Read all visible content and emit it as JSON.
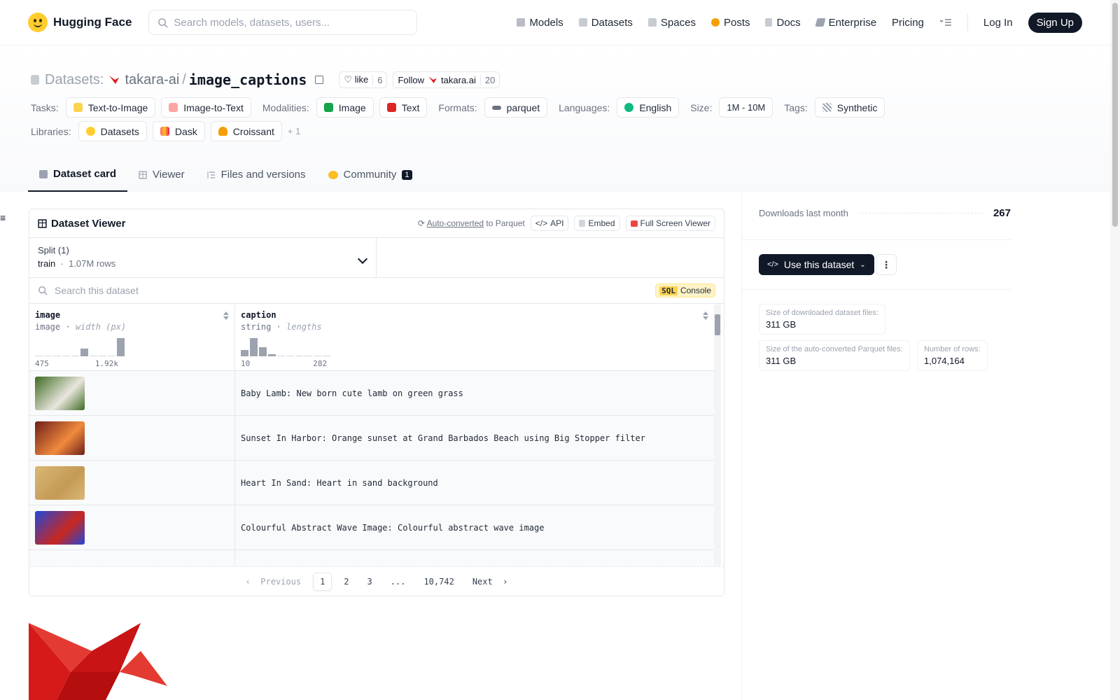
{
  "nav": {
    "brand": "Hugging Face",
    "search_placeholder": "Search models, datasets, users...",
    "links": [
      "Models",
      "Datasets",
      "Spaces",
      "Posts",
      "Docs",
      "Enterprise",
      "Pricing"
    ],
    "login": "Log In",
    "signup": "Sign Up"
  },
  "repo": {
    "section": "Datasets:",
    "owner": "takara-ai",
    "sep": "/",
    "name": "image_captions",
    "like_label": "like",
    "like_count": "6",
    "follow_label": "Follow",
    "follow_org": "takara.ai",
    "follow_count": "20"
  },
  "tags": {
    "tasks_label": "Tasks:",
    "tasks": [
      "Text-to-Image",
      "Image-to-Text"
    ],
    "modalities_label": "Modalities:",
    "modalities": [
      "Image",
      "Text"
    ],
    "formats_label": "Formats:",
    "formats": [
      "parquet"
    ],
    "languages_label": "Languages:",
    "languages": [
      "English"
    ],
    "size_label": "Size:",
    "size": "1M - 10M",
    "tags_label": "Tags:",
    "tag_list": [
      "Synthetic"
    ],
    "libraries_label": "Libraries:",
    "libraries": [
      "Datasets",
      "Dask",
      "Croissant"
    ],
    "libraries_more": "+ 1"
  },
  "tabs": [
    "Dataset card",
    "Viewer",
    "Files and versions",
    "Community"
  ],
  "community_badge": "1",
  "viewer": {
    "title": "Dataset Viewer",
    "auto_converted": "Auto-converted",
    "to_parquet": "to Parquet",
    "api": "API",
    "embed": "Embed",
    "fullscreen": "Full Screen Viewer",
    "split_label": "Split (1)",
    "split_name": "train",
    "split_rows": "1.07M rows",
    "search_placeholder": "Search this dataset",
    "sql_tag": "SQL",
    "sql_label": "Console",
    "columns": [
      {
        "name": "image",
        "type": "image",
        "sub": "width (px)",
        "min": "475",
        "max": "1.92k"
      },
      {
        "name": "caption",
        "type": "string",
        "sub": "lengths",
        "min": "10",
        "max": "282"
      }
    ],
    "rows": [
      {
        "caption": "Baby Lamb: New born cute lamb on green grass",
        "thumb": [
          "#3e6b22",
          "#e9e6de"
        ]
      },
      {
        "caption": "Sunset In Harbor: Orange sunset at Grand Barbados Beach using Big Stopper filter",
        "thumb": [
          "#6e1f1a",
          "#f08a3c"
        ]
      },
      {
        "caption": "Heart In Sand: Heart in sand background",
        "thumb": [
          "#d9b877",
          "#c49a55"
        ]
      },
      {
        "caption": "Colourful Abstract Wave Image: Colourful abstract wave image",
        "thumb": [
          "#2347d8",
          "#c8271f"
        ]
      },
      {
        "caption": "",
        "thumb": [
          "#2f4a1c",
          "#c0392b"
        ]
      }
    ],
    "pager": {
      "prev": "Previous",
      "pages": [
        "1",
        "2",
        "3",
        "...",
        "10,742"
      ],
      "next": "Next"
    }
  },
  "sidebar": {
    "downloads_label": "Downloads last month",
    "downloads_value": "267",
    "use_button": "Use this dataset",
    "stats": [
      {
        "label": "Size of downloaded dataset files:",
        "value": "311 GB"
      },
      {
        "label": "Size of the auto-converted Parquet files:",
        "value": "311 GB"
      },
      {
        "label": "Number of rows:",
        "value": "1,074,164"
      }
    ]
  },
  "colors": {
    "accent_dark": "#111827",
    "hf_yellow": "#ffcd2e",
    "takara_red": "#e11d1d"
  }
}
